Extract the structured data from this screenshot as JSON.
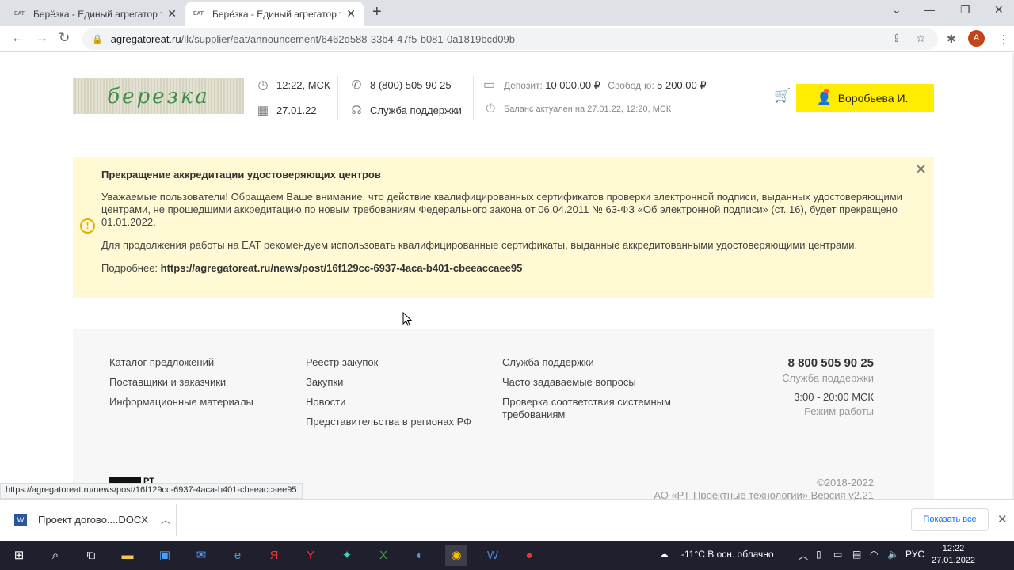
{
  "browser": {
    "tabs": [
      {
        "favicon": "EAT",
        "title": "Берёзка - Единый агрегатор тор",
        "active": false
      },
      {
        "favicon": "EAT",
        "title": "Берёзка - Единый агрегатор тор",
        "active": true
      }
    ],
    "url_host": "agregatoreat.ru",
    "url_path": "/lk/supplier/eat/announcement/6462d588-33b4-47f5-b081-0a1819bcd09b",
    "avatar_letter": "A"
  },
  "header": {
    "logo_text": "березка",
    "time": "12:22, МСК",
    "date": "27.01.22",
    "phone": "8 (800) 505 90 25",
    "support": "Служба поддержки",
    "deposit_label": "Депозит:",
    "deposit_value": "10 000,00 ₽",
    "free_label": "Свободно:",
    "free_value": "5 200,00 ₽",
    "balance_note": "Баланс актуален на 27.01.22, 12:20, МСК",
    "user_name": "Воробьева И."
  },
  "notice": {
    "title": "Прекращение аккредитации удостоверяющих центров",
    "paragraph1": "Уважаемые пользователи! Обращаем Ваше внимание, что действие квалифицированных сертификатов проверки электронной подписи, выданных удостоверяющими центрами, не прошедшими аккредитацию по новым требованиям Федерального закона от 06.04.2011 № 63-ФЗ «Об электронной подписи» (ст. 16), будет прекращено 01.01.2022.",
    "paragraph2": "Для продолжения работы на ЕАТ рекомендуем использовать квалифицированные сертификаты, выданные аккредитованными удостоверяющими центрами.",
    "more_label": "Подробнее:",
    "more_link": "https://agregatoreat.ru/news/post/16f129cc-6937-4aca-b401-cbeeaccaee95"
  },
  "footer": {
    "col1": [
      "Каталог предложений",
      "Поставщики и заказчики",
      "Информационные материалы"
    ],
    "col2": [
      "Реестр закупок",
      "Закупки",
      "Новости",
      "Представительства в регионах РФ"
    ],
    "col3": [
      "Служба поддержки",
      "Часто задаваемые вопросы",
      "Проверка соответствия системным требованиям"
    ],
    "phone": "8 800 505 90 25",
    "phone_sub": "Служба поддержки",
    "hours": "3:00 - 20:00 МСК",
    "hours_sub": "Режим работы",
    "copyright": "©2018-2022",
    "company": "АО «РТ-Проектные технологии» Версия v2.21",
    "logo_text": "РТ"
  },
  "status_url": "https://agregatoreat.ru/news/post/16f129cc-6937-4aca-b401-cbeeaccaee95",
  "downloads": {
    "file": "Проект догово....DOCX",
    "show_all": "Показать все"
  },
  "taskbar": {
    "weather": "-11°C  В осн. облачно",
    "lang": "РУС",
    "time": "12:22",
    "date": "27.01.2022"
  },
  "colors": {
    "accent_yellow": "#ffec00",
    "notice_bg": "#fff9d4",
    "logo_green": "#3e8d46"
  }
}
